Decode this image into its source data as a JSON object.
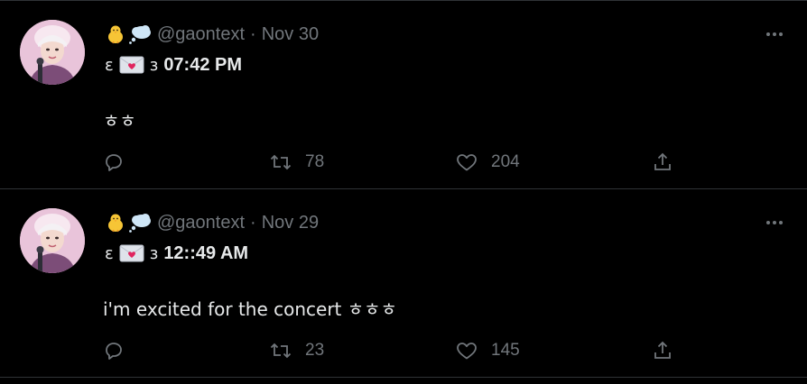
{
  "colors": {
    "background": "#000000",
    "divider": "#2f3336",
    "primary_text": "#e7e9ea",
    "secondary_text": "#71767b"
  },
  "tweets": [
    {
      "handle": "@gaontext",
      "separator": "·",
      "date": "Nov 30",
      "bracket_left": "ɛ",
      "bracket_right": "ɜ",
      "time": "07:42 PM",
      "text": "ㅎㅎ",
      "retweets": "78",
      "likes": "204",
      "icons": [
        "chick-emoji-icon",
        "thought-bubble-emoji-icon",
        "love-letter-emoji-icon",
        "more-icon",
        "reply-icon",
        "retweet-icon",
        "like-icon",
        "share-icon"
      ]
    },
    {
      "handle": "@gaontext",
      "separator": "·",
      "date": "Nov 29",
      "bracket_left": "ɛ",
      "bracket_right": "ɜ",
      "time": "12::49 AM",
      "text": "i'm excited for the concert ㅎㅎㅎ",
      "retweets": "23",
      "likes": "145",
      "icons": [
        "chick-emoji-icon",
        "thought-bubble-emoji-icon",
        "love-letter-emoji-icon",
        "more-icon",
        "reply-icon",
        "retweet-icon",
        "like-icon",
        "share-icon"
      ]
    }
  ]
}
